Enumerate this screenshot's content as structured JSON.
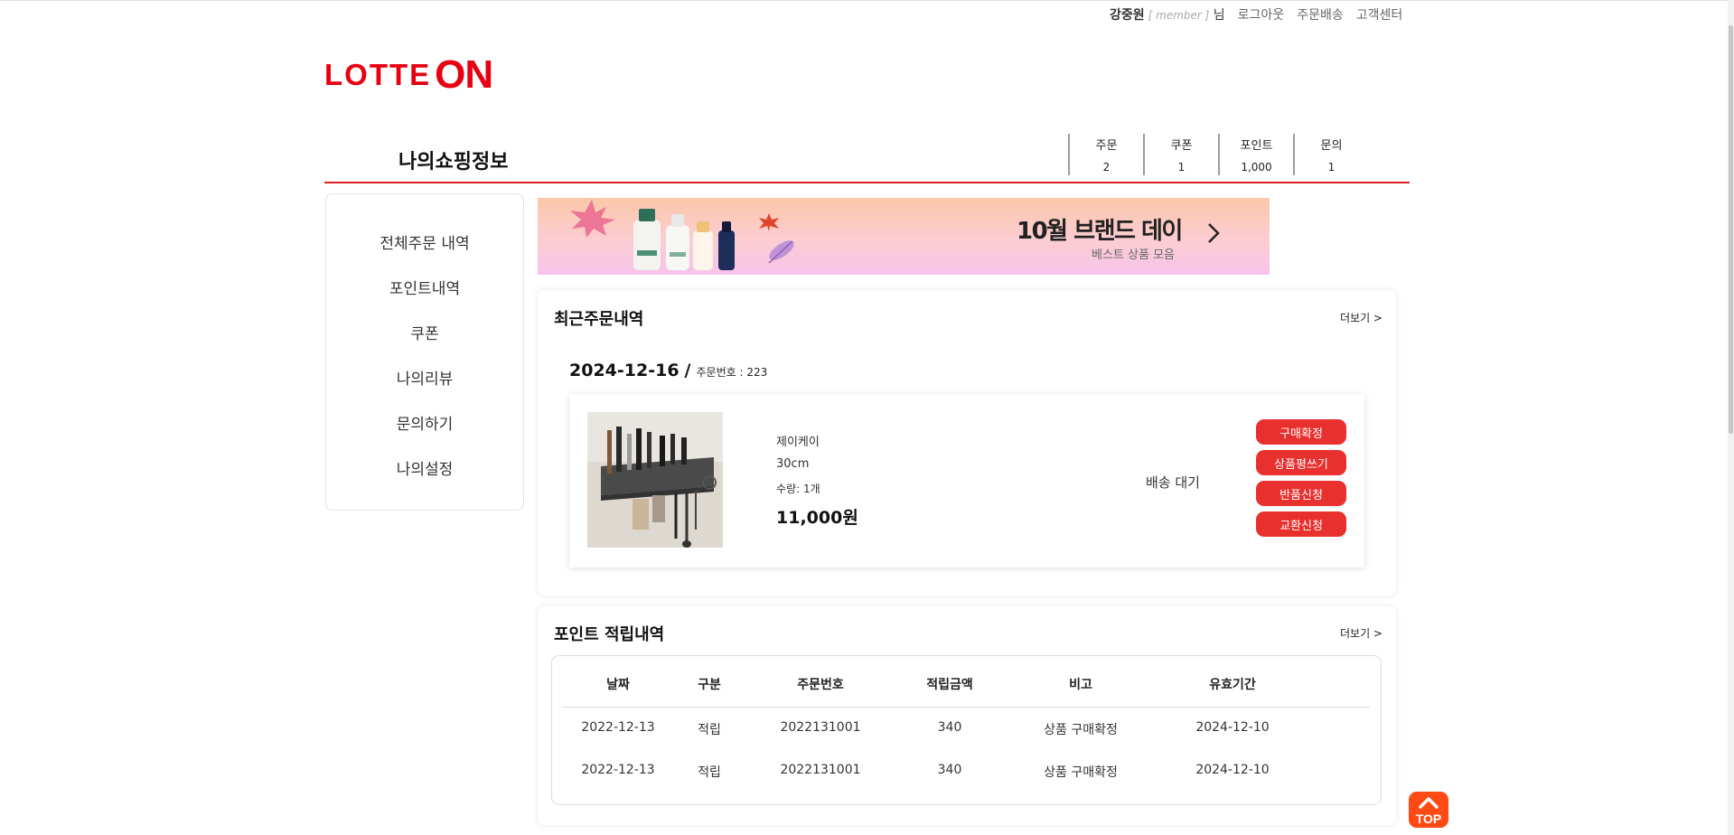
{
  "util_nav": {
    "user_name": "강중원",
    "grade": "[ member ]",
    "suffix": "님",
    "logout": "로그아웃",
    "order_delivery": "주문배송",
    "customer_center": "고객센터"
  },
  "brand": {
    "word": "LOTTE",
    "on": "ON",
    "color": "#e60012"
  },
  "page_title": "나의쇼핑정보",
  "stats": [
    {
      "label": "주문",
      "value": "2"
    },
    {
      "label": "쿠폰",
      "value": "1"
    },
    {
      "label": "포인트",
      "value": "1,000"
    },
    {
      "label": "문의",
      "value": "1"
    }
  ],
  "sidebar": {
    "items": [
      "전체주문 내역",
      "포인트내역",
      "쿠폰",
      "나의리뷰",
      "문의하기",
      "나의설정"
    ]
  },
  "banner": {
    "title": "10월 브랜드 데이",
    "subtitle": "베스트 상품 모음"
  },
  "recent_orders": {
    "title": "최근주문내역",
    "more": "더보기 >",
    "date": "2024-12-16",
    "slash": "/",
    "order_no": "주문번호 : 223",
    "product": {
      "brand": "제이케이",
      "option": "30cm",
      "qty": "수량: 1개",
      "price": "11,000원",
      "image_icon": "kitchen-knife-rack-image"
    },
    "status": "배송 대기",
    "buttons": {
      "confirm": "구매확정",
      "review": "상품평쓰기",
      "return": "반품신청",
      "exchange": "교환신청"
    }
  },
  "points": {
    "title": "포인트 적립내역",
    "more": "더보기 >",
    "headers": [
      "날짜",
      "구분",
      "주문번호",
      "적립금액",
      "비고",
      "유효기간"
    ],
    "rows": [
      [
        "2022-12-13",
        "적립",
        "2022131001",
        "340",
        "상품 구매확정",
        "2024-12-10"
      ],
      [
        "2022-12-13",
        "적립",
        "2022131001",
        "340",
        "상품 구매확정",
        "2024-12-10"
      ]
    ]
  },
  "top_button": "TOP",
  "colors": {
    "accent": "#e02020",
    "button": "#e8302e",
    "top_button": "#ff4a16"
  }
}
